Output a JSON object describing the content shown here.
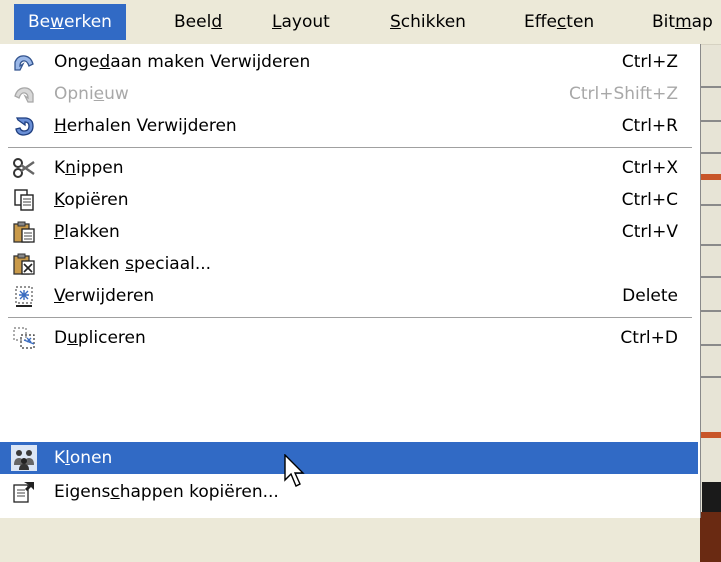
{
  "menubar": {
    "items": [
      {
        "pre": "Be",
        "key": "w",
        "post": "erken"
      },
      {
        "pre": "Beel",
        "key": "d",
        "post": ""
      },
      {
        "pre": "",
        "key": "L",
        "post": "ayout"
      },
      {
        "pre": "",
        "key": "S",
        "post": "chikken"
      },
      {
        "pre": "Effe",
        "key": "c",
        "post": "ten"
      },
      {
        "pre": "Bit",
        "key": "m",
        "post": "ap"
      }
    ]
  },
  "menu": {
    "undo": {
      "pre": "Onge",
      "key": "d",
      "post": "aan maken Verwijderen",
      "shortcut": "Ctrl+Z",
      "icon": "undo-icon"
    },
    "redo": {
      "pre": "Opni",
      "key": "e",
      "post": "uw",
      "shortcut": "Ctrl+Shift+Z",
      "icon": "redo-icon",
      "disabled": true
    },
    "repeat": {
      "pre": "",
      "key": "H",
      "post": "erhalen Verwijderen",
      "shortcut": "Ctrl+R",
      "icon": "repeat-icon"
    },
    "cut": {
      "pre": "K",
      "key": "n",
      "post": "ippen",
      "shortcut": "Ctrl+X",
      "icon": "scissors-icon"
    },
    "copy": {
      "pre": "",
      "key": "K",
      "post": "opiëren",
      "shortcut": "Ctrl+C",
      "icon": "copy-icon"
    },
    "paste": {
      "pre": "",
      "key": "P",
      "post": "lakken",
      "shortcut": "Ctrl+V",
      "icon": "paste-icon"
    },
    "paste_special": {
      "pre": "Plakken ",
      "key": "s",
      "post": "peciaal...",
      "shortcut": "",
      "icon": "paste-special-icon"
    },
    "delete": {
      "pre": "",
      "key": "V",
      "post": "erwijderen",
      "shortcut": "Delete",
      "icon": "delete-icon"
    },
    "duplicate": {
      "pre": "D",
      "key": "u",
      "post": "pliceren",
      "shortcut": "Ctrl+D",
      "icon": "duplicate-icon"
    },
    "clone": {
      "pre": "K",
      "key": "l",
      "post": "onen",
      "shortcut": "",
      "icon": "clone-icon",
      "highlighted": true
    },
    "copy_props": {
      "pre": "Eigens",
      "key": "c",
      "post": "happen kopiëren...",
      "shortcut": "",
      "icon": "copy-properties-icon"
    }
  },
  "colors": {
    "highlight": "#316ac5",
    "menubar_bg": "#ece9d8",
    "disabled_text": "#a8a8a8"
  }
}
